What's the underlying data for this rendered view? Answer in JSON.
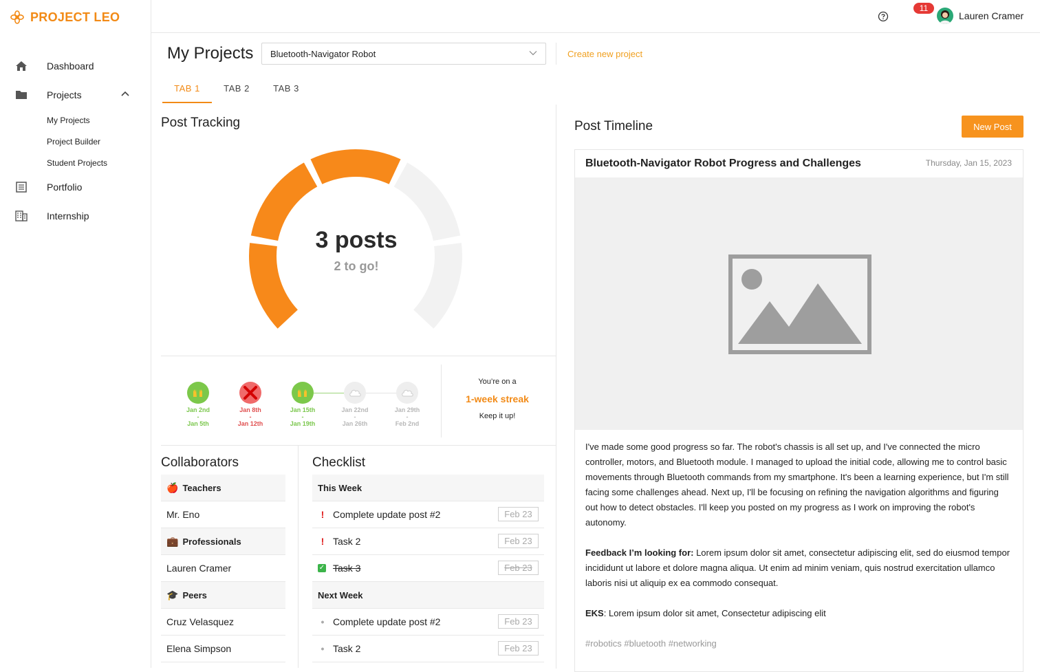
{
  "brand": {
    "name": "PROJECT LEO",
    "color": "#f28a16"
  },
  "sidebar": {
    "items": [
      {
        "label": "Dashboard",
        "icon": "home-icon"
      },
      {
        "label": "Projects",
        "icon": "folder-icon"
      },
      {
        "label": "Portfolio",
        "icon": "list-icon"
      },
      {
        "label": "Internship",
        "icon": "building-icon"
      }
    ],
    "project_subitems": [
      "My Projects",
      "Project Builder",
      "Student Projects"
    ]
  },
  "topbar": {
    "notifications": "11",
    "user_name": "Lauren Cramer"
  },
  "header": {
    "title": "My Projects",
    "selected_project": "Bluetooth-Navigator Robot",
    "create_link": "Create new project"
  },
  "tabs": [
    "TAB 1",
    "TAB 2",
    "TAB 3"
  ],
  "active_tab": 0,
  "tracking": {
    "title": "Post Tracking",
    "posts": "3 posts",
    "to_go": "2 to go!",
    "completed": 3,
    "goal": 5,
    "weeks": [
      {
        "start": "Jan 2nd",
        "sep": "-",
        "end": "Jan 5th",
        "status": "good"
      },
      {
        "start": "Jan 8th",
        "sep": "-",
        "end": "Jan 12th",
        "status": "bad"
      },
      {
        "start": "Jan 15th",
        "sep": "-",
        "end": "Jan 19th",
        "status": "good"
      },
      {
        "start": "Jan 22nd",
        "sep": "-",
        "end": "Jan 26th",
        "status": "future"
      },
      {
        "start": "Jan 29th",
        "sep": "-",
        "end": "Feb 2nd",
        "status": "future"
      }
    ],
    "streak": {
      "line1": "You’re on a",
      "line2": "1-week streak",
      "line3": "Keep it up!"
    }
  },
  "collaborators": {
    "title": "Collaborators",
    "groups": [
      {
        "label": "Teachers",
        "emoji": "🍎",
        "members": [
          "Mr. Eno"
        ]
      },
      {
        "label": "Professionals",
        "emoji": "💼",
        "members": [
          "Lauren Cramer"
        ]
      },
      {
        "label": "Peers",
        "emoji": "🎓",
        "members": [
          "Cruz Velasquez",
          "Elena Simpson"
        ]
      }
    ]
  },
  "checklist": {
    "title": "Checklist",
    "this_week": "This Week",
    "next_week": "Next Week",
    "this_week_items": [
      {
        "label": "Complete update post #2",
        "mark": "!",
        "date": "Feb 23",
        "done": false
      },
      {
        "label": "Task 2",
        "mark": "!",
        "date": "Feb 23",
        "done": false
      },
      {
        "label": "Task 3",
        "mark": "✓",
        "date": "Feb 23",
        "done": true
      }
    ],
    "next_week_items": [
      {
        "label": "Complete update post #2",
        "mark": "•",
        "date": "Feb 23",
        "done": false
      },
      {
        "label": "Task 2",
        "mark": "•",
        "date": "Feb 23",
        "done": false
      }
    ]
  },
  "timeline": {
    "title": "Post Timeline",
    "new_post": "New Post",
    "post": {
      "title": "Bluetooth-Navigator Robot Progress and Challenges",
      "date": "Thursday, Jan 15, 2023",
      "body": "I've made some good progress so far. The robot's chassis is all set up, and I've connected the micro controller, motors, and Bluetooth module. I managed to upload the initial code, allowing me to control basic movements through Bluetooth commands from my smartphone. It's been a learning experience, but I'm still facing some challenges ahead. Next up, I'll be focusing on refining the navigation algorithms and figuring out how to detect obstacles. I'll keep you posted on my progress as I work on improving the robot's autonomy.",
      "feedback_label": "Feedback I’m looking for:",
      "feedback_text": " Lorem ipsum dolor sit amet, consectetur adipiscing elit, sed do eiusmod tempor incididunt ut labore et dolore magna aliqua. Ut enim ad minim veniam, quis nostrud exercitation ullamco laboris nisi ut aliquip ex ea commodo consequat.",
      "eks_label": "EKS",
      "eks_text": ": Lorem ipsum dolor sit amet, Consectetur adipiscing elit",
      "tags": "#robotics #bluetooth #networking"
    }
  }
}
